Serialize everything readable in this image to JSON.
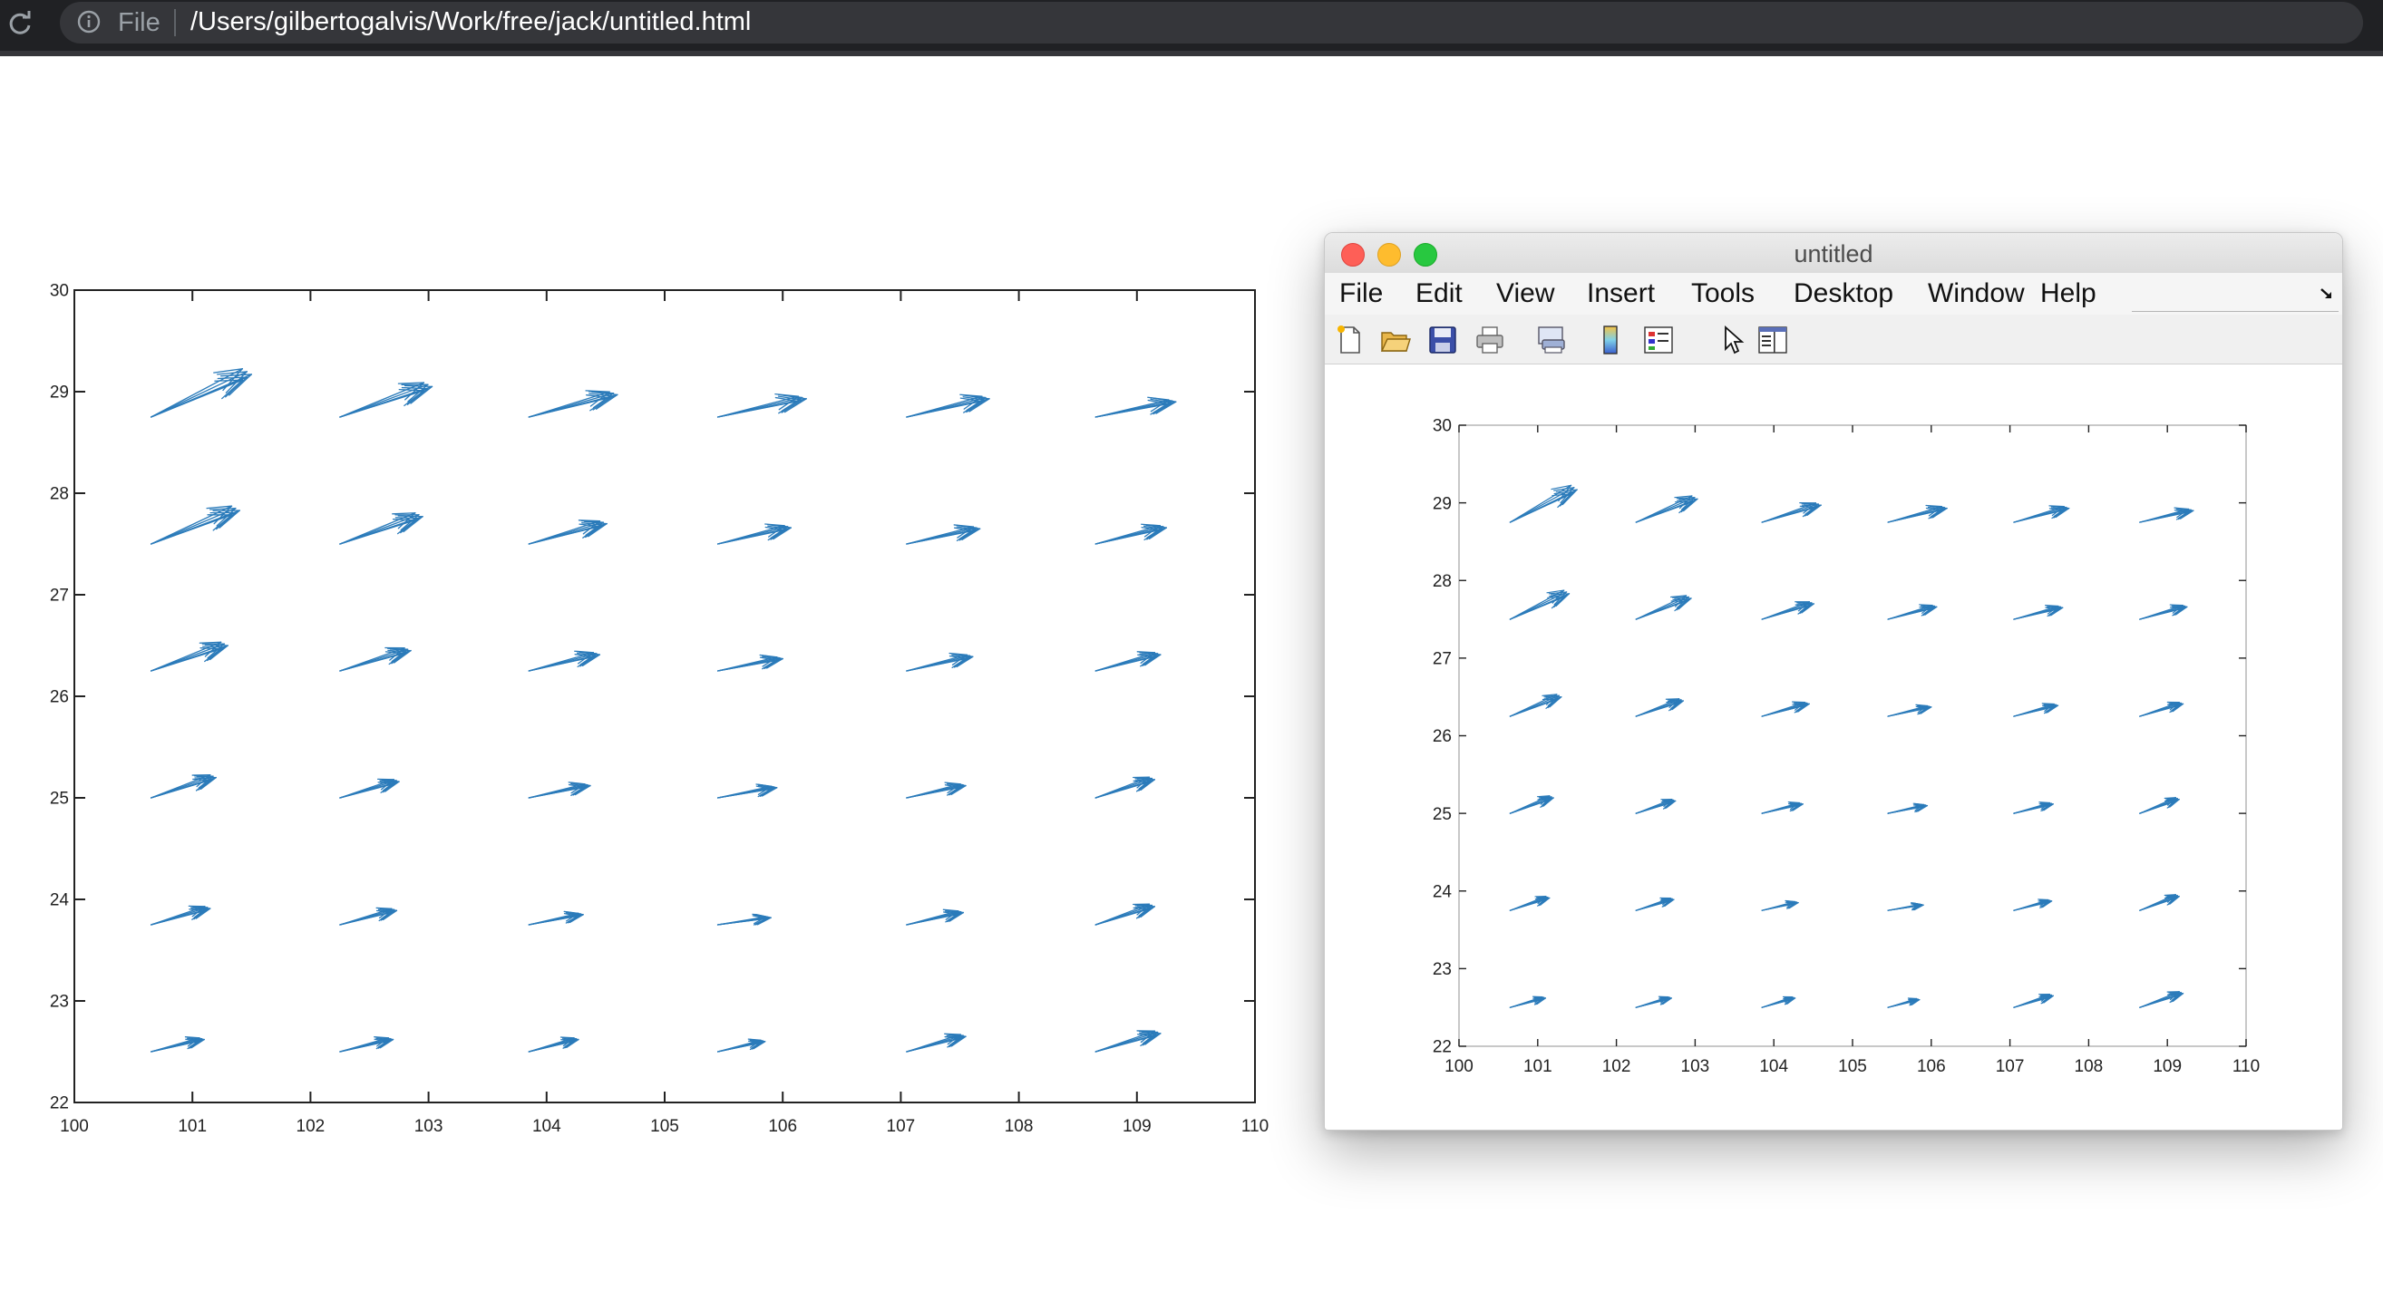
{
  "browser": {
    "scheme_label": "File",
    "url": "/Users/gilbertogalvis/Work/free/jack/untitled.html",
    "icons": {
      "reload": "reload-icon",
      "info": "info-icon"
    }
  },
  "window": {
    "title": "untitled",
    "menu": [
      "File",
      "Edit",
      "View",
      "Insert",
      "Tools",
      "Desktop",
      "Window",
      "Help"
    ],
    "toolbar_icons": [
      "new-figure-icon",
      "open-file-icon",
      "save-icon",
      "print-icon",
      "print-preview-icon",
      "colorbar-icon",
      "legend-icon",
      "select-pointer-icon",
      "property-editor-icon"
    ]
  },
  "colors": {
    "quiver": "#2b7bba",
    "axis": "#222222"
  },
  "chart_data": {
    "type": "quiver",
    "xlim": [
      100,
      110
    ],
    "ylim": [
      22,
      30
    ],
    "xticks": [
      100,
      101,
      102,
      103,
      104,
      105,
      106,
      107,
      108,
      109,
      110
    ],
    "yticks": [
      22,
      23,
      24,
      25,
      26,
      27,
      28,
      29,
      30
    ],
    "grid": false,
    "rows": [
      {
        "y": 22.5,
        "x": [
          100.65,
          102.25,
          103.85,
          105.45,
          107.05,
          108.65
        ],
        "u": [
          0.45,
          0.45,
          0.42,
          0.4,
          0.5,
          0.55
        ],
        "v": [
          0.12,
          0.12,
          0.12,
          0.1,
          0.15,
          0.18
        ]
      },
      {
        "y": 23.75,
        "x": [
          100.65,
          102.25,
          103.85,
          105.45,
          107.05,
          108.65
        ],
        "u": [
          0.5,
          0.48,
          0.46,
          0.45,
          0.48,
          0.5
        ],
        "v": [
          0.16,
          0.14,
          0.1,
          0.07,
          0.12,
          0.18
        ]
      },
      {
        "y": 25.0,
        "x": [
          100.65,
          102.25,
          103.85,
          105.45,
          107.05,
          108.65
        ],
        "u": [
          0.55,
          0.5,
          0.52,
          0.5,
          0.5,
          0.5
        ],
        "v": [
          0.2,
          0.16,
          0.12,
          0.1,
          0.12,
          0.18
        ]
      },
      {
        "y": 26.25,
        "x": [
          100.65,
          102.25,
          103.85,
          105.45,
          107.05,
          108.65
        ],
        "u": [
          0.65,
          0.6,
          0.6,
          0.55,
          0.56,
          0.55
        ],
        "v": [
          0.25,
          0.2,
          0.16,
          0.12,
          0.14,
          0.16
        ]
      },
      {
        "y": 27.5,
        "x": [
          100.65,
          102.25,
          103.85,
          105.45,
          107.05,
          108.65
        ],
        "u": [
          0.75,
          0.7,
          0.66,
          0.62,
          0.62,
          0.6
        ],
        "v": [
          0.33,
          0.27,
          0.2,
          0.16,
          0.15,
          0.16
        ]
      },
      {
        "y": 28.75,
        "x": [
          100.65,
          102.25,
          103.85,
          105.45,
          107.05,
          108.65
        ],
        "u": [
          0.85,
          0.78,
          0.75,
          0.75,
          0.7,
          0.68
        ],
        "v": [
          0.42,
          0.3,
          0.22,
          0.18,
          0.18,
          0.15
        ]
      }
    ]
  }
}
